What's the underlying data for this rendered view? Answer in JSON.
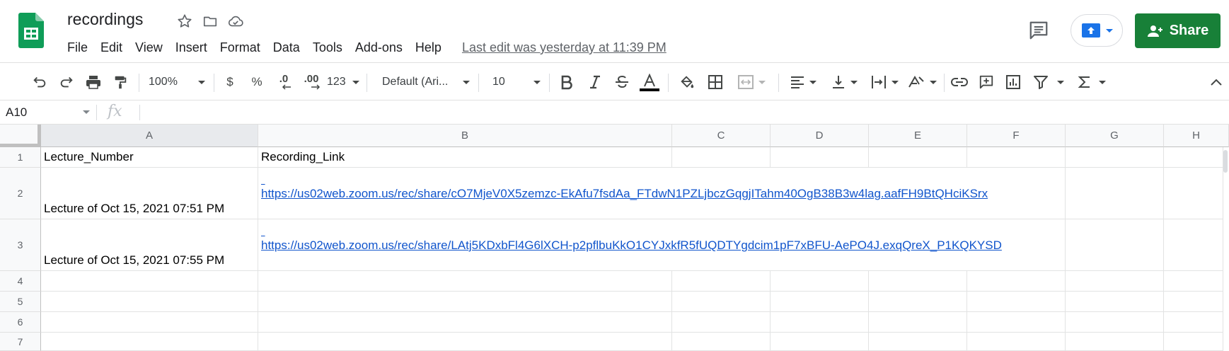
{
  "header": {
    "doc_title": "recordings",
    "menu": [
      "File",
      "Edit",
      "View",
      "Insert",
      "Format",
      "Data",
      "Tools",
      "Add-ons",
      "Help"
    ],
    "last_edit": "Last edit was yesterday at 11:39 PM",
    "share_label": "Share"
  },
  "toolbar": {
    "zoom": "100%",
    "currency": "$",
    "percent": "%",
    "decrease_decimal": ".0",
    "increase_decimal": ".00",
    "more_formats": "123",
    "font": "Default (Ari...",
    "font_size": "10"
  },
  "formula_bar": {
    "cell_ref": "A10",
    "fx": "fx",
    "value": ""
  },
  "grid": {
    "columns": [
      "A",
      "B",
      "C",
      "D",
      "E",
      "F",
      "G",
      "H"
    ],
    "selected_column": "A",
    "rows": [
      "1",
      "2",
      "3",
      "4",
      "5",
      "6",
      "7"
    ],
    "cells": {
      "A1": "Lecture_Number",
      "B1": "Recording_Link",
      "A2": "Lecture of Oct 15, 2021 07:51 PM",
      "B2": "https://us02web.zoom.us/rec/share/cO7MjeV0X5zemzc-EkAfu7fsdAa_FTdwN1PZLjbczGqgjITahm40OgB38B3w4lag.aafFH9BtQHciKSrx",
      "A3": "Lecture of Oct 15, 2021 07:55 PM",
      "B3": "https://us02web.zoom.us/rec/share/LAtj5KDxbFl4G6lXCH-p2pflbuKkO1CYJxkfR5fUQDTYgdcim1pF7xBFU-AePO4J.exqQreX_P1KQKYSD"
    }
  },
  "colors": {
    "sheets_green": "#188038",
    "link_blue": "#1155cc",
    "header_bg": "#f8f9fa"
  }
}
